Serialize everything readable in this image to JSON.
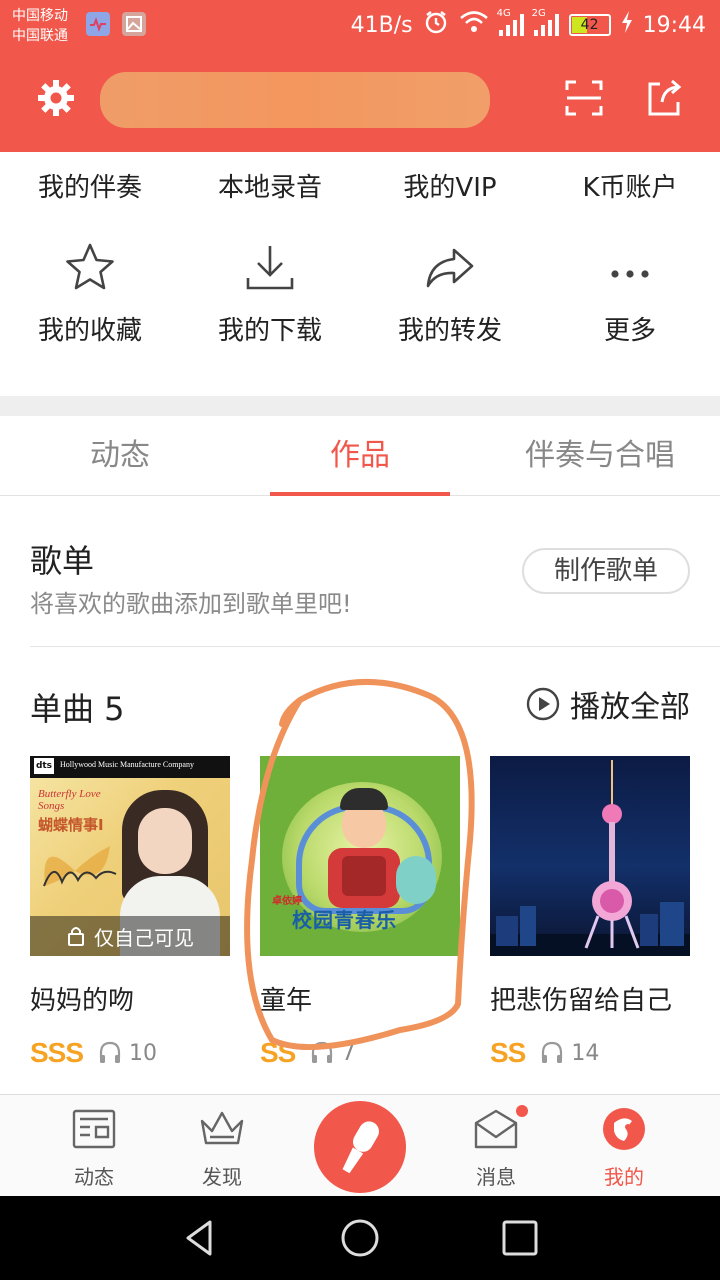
{
  "status_bar": {
    "carrier_1": "中国移动",
    "carrier_2": "中国联通",
    "speed": "41B/s",
    "net_4g": "4G",
    "net_2g": "2G",
    "battery": "42",
    "time": "19:44"
  },
  "header": {
    "settings_icon": "gear-icon",
    "scan_icon": "scan-icon",
    "share_icon": "share-icon"
  },
  "menu": {
    "row1": [
      "我的伴奏",
      "本地录音",
      "我的VIP",
      "K币账户"
    ],
    "row2": [
      {
        "label": "我的收藏",
        "icon": "star-icon"
      },
      {
        "label": "我的下载",
        "icon": "download-icon"
      },
      {
        "label": "我的转发",
        "icon": "forward-icon"
      },
      {
        "label": "更多",
        "icon": "more-icon"
      }
    ]
  },
  "tabs": {
    "items": [
      "动态",
      "作品",
      "伴奏与合唱"
    ],
    "active": "作品"
  },
  "playlist": {
    "title": "歌单",
    "subtitle": "将喜欢的歌曲添加到歌单里吧!",
    "create_button": "制作歌单"
  },
  "singles": {
    "title": "单曲 5",
    "play_all": "播放全部",
    "items": [
      {
        "name": "妈妈的吻",
        "grade": "SSS",
        "plays": "10",
        "private_label": "仅自己可见",
        "cover_text_top": "Hollywood Music Manufacture Company",
        "cover_text_series": "Butterfly Love Songs",
        "cover_text_cn": "蝴蝶情事Ⅰ"
      },
      {
        "name": "童年",
        "grade": "SS",
        "plays": "7",
        "cover_text_cn": "校园青春乐",
        "cover_artist": "卓依婷"
      },
      {
        "name": "把悲伤留给自己",
        "grade": "SS",
        "plays": "14"
      }
    ]
  },
  "bottom_nav": {
    "items": [
      "动态",
      "发现",
      "消息",
      "我的"
    ],
    "active": "我的"
  },
  "colors": {
    "brand_red": "#f1574a",
    "grade_gold": "#f6a323",
    "annotation_orange": "#f0935a"
  }
}
